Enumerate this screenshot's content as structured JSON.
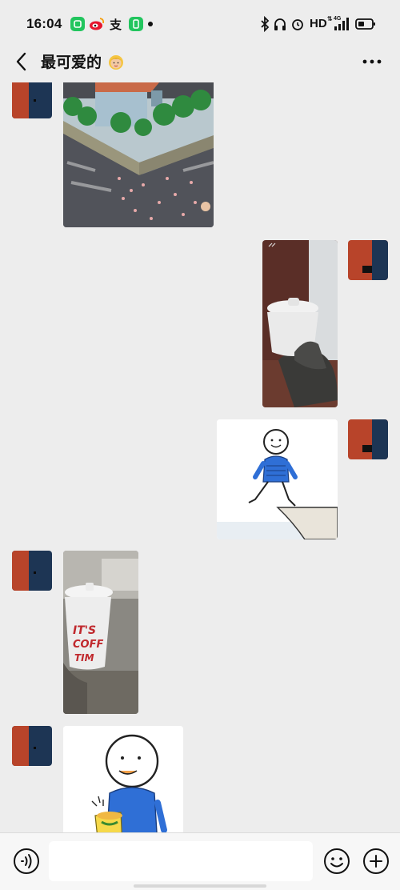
{
  "status_bar": {
    "time": "16:04",
    "hd_label": "HD",
    "network_label": "4G",
    "icons": [
      "app-green-icon",
      "weibo-icon",
      "alipay-icon",
      "app-green-2-icon",
      "dot-icon",
      "bluetooth-icon",
      "headphones-icon",
      "alarm-icon",
      "signal-icon",
      "battery-icon"
    ]
  },
  "header": {
    "title": "最可爱的",
    "title_emoji": "blonde-girl-emoji",
    "back_icon": "chevron-left-icon",
    "more_icon": "more-dots-icon"
  },
  "messages": [
    {
      "side": "left",
      "kind": "image",
      "description_icon": "cartoon-house-street"
    },
    {
      "side": "right",
      "kind": "video",
      "description_icon": "hand-holding-cup"
    },
    {
      "side": "right",
      "kind": "sticker",
      "description_icon": "walking-figure-sticker"
    },
    {
      "side": "left",
      "kind": "video",
      "description_icon": "coffee-cup"
    },
    {
      "side": "left",
      "kind": "sticker",
      "description_icon": "eating-figure-sticker"
    }
  ],
  "sticker_cup_text": [
    "IT'S",
    "COFF",
    "TIM"
  ],
  "input_bar": {
    "placeholder": "",
    "voice_icon": "voice-icon",
    "emoji_icon": "emoji-smile-icon",
    "plus_icon": "plus-icon"
  },
  "colors": {
    "background": "#ededed",
    "avatar_red": "#b8442a",
    "avatar_navy": "#1d3554",
    "input_bar": "#f7f7f7"
  }
}
